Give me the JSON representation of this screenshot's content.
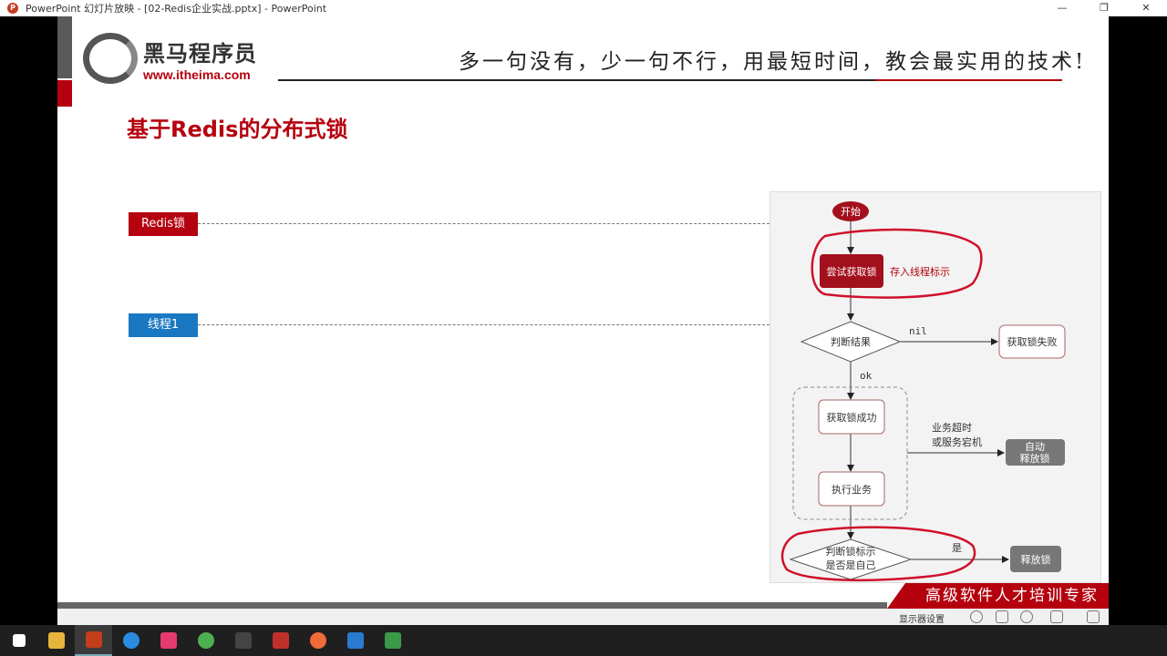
{
  "window": {
    "title": "PowerPoint 幻灯片放映 - [02-Redis企业实战.pptx] - PowerPoint",
    "app_icon": "P",
    "minimize": "—",
    "maximize": "❐",
    "close": "✕"
  },
  "slide": {
    "logo": {
      "cn": "黑马程序员",
      "url": "www.itheima.com"
    },
    "slogan": "多一句没有，少一句不行，用最短时间，教会最实用的技术!",
    "title": "基于Redis的分布式锁",
    "tags": {
      "redis": "Redis锁",
      "thread": "线程1"
    },
    "footer": "高级软件人才培训专家"
  },
  "flow": {
    "start": "开始",
    "try_lock": "尝试获取锁",
    "store_note": "存入线程标示",
    "judge": "判断结果",
    "nil": "nil",
    "fail": "获取锁失败",
    "ok": "ok",
    "success": "获取锁成功",
    "exec": "执行业务",
    "timeout1": "业务超时",
    "timeout2": "或服务宕机",
    "auto1": "自动",
    "auto2": "释放锁",
    "check1": "判断锁标示",
    "check2": "是否是自己",
    "yes": "是",
    "release": "释放锁"
  },
  "statusbar": {
    "display_settings": "显示器设置"
  },
  "colors": {
    "brand_red": "#b5000e",
    "blue": "#1a78c2",
    "gray_box": "#777777"
  }
}
